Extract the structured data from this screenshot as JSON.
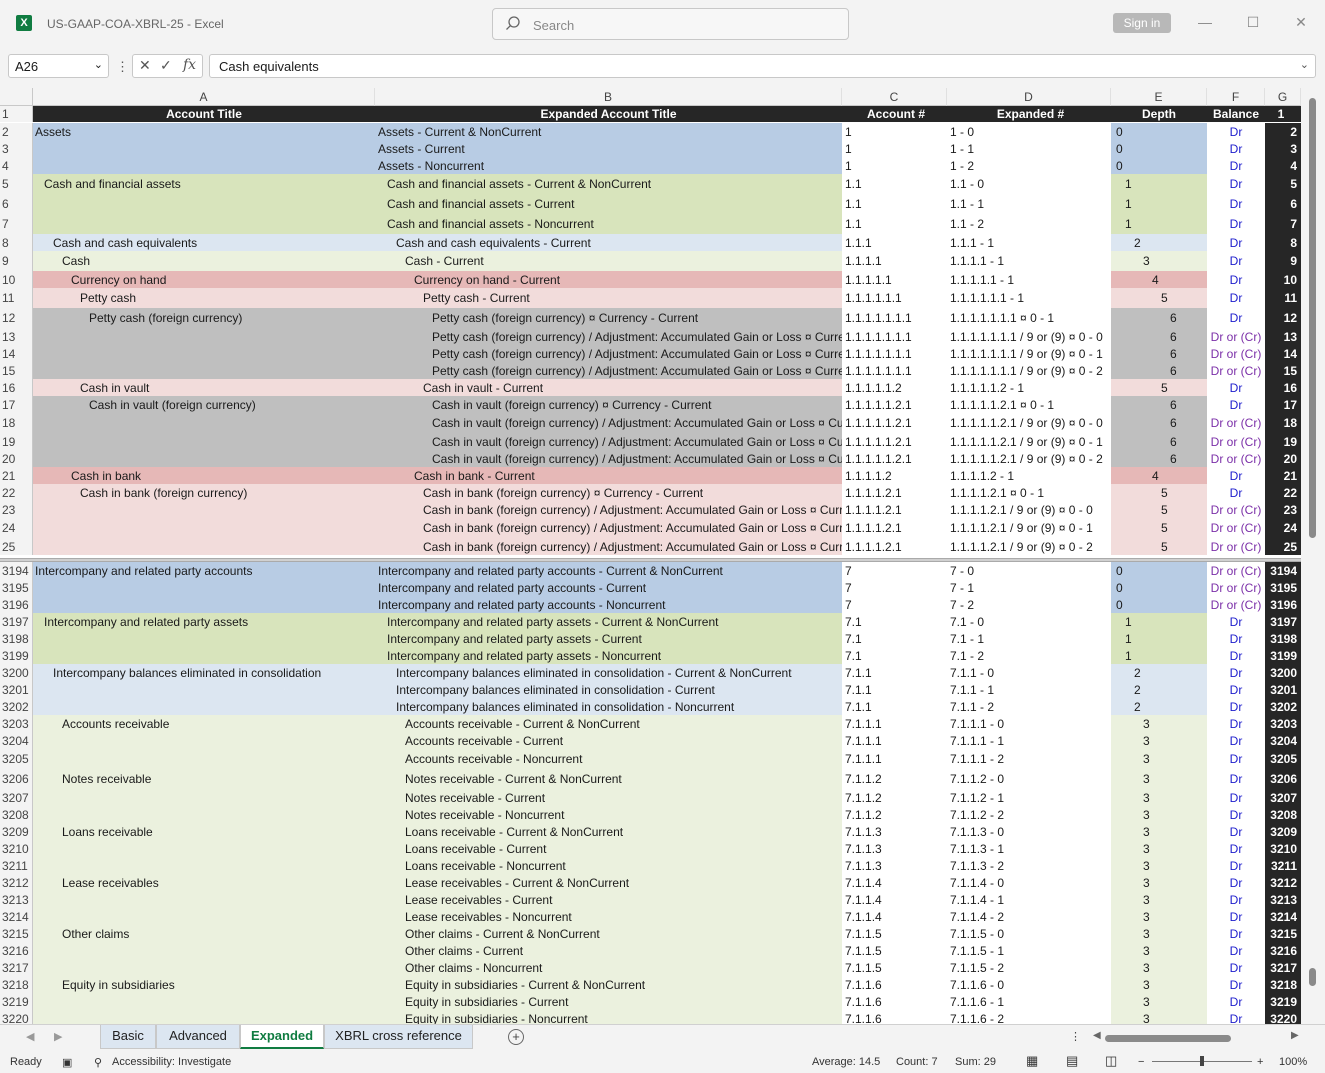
{
  "window": {
    "doc_title": "US-GAAP-COA-XBRL-25  -  Excel",
    "search_placeholder": "Search",
    "signin_label": "Sign in"
  },
  "formula_bar": {
    "name_box": "A26",
    "formula": "Cash equivalents"
  },
  "columns": [
    "A",
    "B",
    "C",
    "D",
    "E",
    "F",
    "G"
  ],
  "header_row": {
    "rn": "1",
    "a": "Account Title",
    "b": "Expanded Account Title",
    "c": "Account #",
    "d": "Expanded #",
    "e": "Depth",
    "f": "Balance",
    "g": "1"
  },
  "rows_top": [
    {
      "rn": "2",
      "a": "Assets",
      "b": "Assets - Current & NonCurrent",
      "c": "1",
      "d": "1 - 0",
      "e": "0",
      "f": "Dr",
      "g": "2",
      "color": "bl",
      "indent": 0
    },
    {
      "rn": "3",
      "a": "",
      "b": "Assets - Current",
      "c": "1",
      "d": "1 - 1",
      "e": "0",
      "f": "Dr",
      "g": "3",
      "color": "bl",
      "indent": 0
    },
    {
      "rn": "4",
      "a": "",
      "b": "Assets - Noncurrent",
      "c": "1",
      "d": "1 - 2",
      "e": "0",
      "f": "Dr",
      "g": "4",
      "color": "bl",
      "indent": 0
    },
    {
      "rn": "5",
      "a": "Cash and financial assets",
      "b": "Cash and financial assets - Current & NonCurrent",
      "c": "1.1",
      "d": "1.1 - 0",
      "e": "1",
      "f": "Dr",
      "g": "5",
      "color": "gr",
      "indent": 1
    },
    {
      "rn": "6",
      "a": "",
      "b": "Cash and financial assets - Current",
      "c": "1.1",
      "d": "1.1 - 1",
      "e": "1",
      "f": "Dr",
      "g": "6",
      "color": "gr",
      "indent": 1
    },
    {
      "rn": "7",
      "a": "",
      "b": "Cash and financial assets - Noncurrent",
      "c": "1.1",
      "d": "1.1 - 2",
      "e": "1",
      "f": "Dr",
      "g": "7",
      "color": "gr",
      "indent": 1
    },
    {
      "rn": "8",
      "a": "Cash and cash equivalents",
      "b": "Cash and cash equivalents - Current",
      "c": "1.1.1",
      "d": "1.1.1 - 1",
      "e": "2",
      "f": "Dr",
      "g": "8",
      "color": "lb",
      "indent": 2
    },
    {
      "rn": "9",
      "a": "Cash",
      "b": "Cash - Current",
      "c": "1.1.1.1",
      "d": "1.1.1.1 - 1",
      "e": "3",
      "f": "Dr",
      "g": "9",
      "color": "lg",
      "indent": 3
    },
    {
      "rn": "10",
      "a": "Currency on hand",
      "b": "Currency on hand - Current",
      "c": "1.1.1.1.1",
      "d": "1.1.1.1.1 - 1",
      "e": "4",
      "f": "Dr",
      "g": "10",
      "color": "rd",
      "indent": 4
    },
    {
      "rn": "11",
      "a": "Petty cash",
      "b": "Petty cash - Current",
      "c": "1.1.1.1.1.1",
      "d": "1.1.1.1.1.1 - 1",
      "e": "5",
      "f": "Dr",
      "g": "11",
      "color": "pk",
      "indent": 5
    },
    {
      "rn": "12",
      "a": "Petty cash (foreign currency)",
      "b": "Petty cash (foreign currency) ¤ Currency - Current",
      "c": "1.1.1.1.1.1.1",
      "d": "1.1.1.1.1.1.1 ¤ 0 - 1",
      "e": "6",
      "f": "Dr",
      "g": "12",
      "color": "gy",
      "indent": 6
    },
    {
      "rn": "13",
      "a": "",
      "b": "Petty cash (foreign currency) / Adjustment: Accumulated Gain or Loss ¤ Currency",
      "c": "1.1.1.1.1.1.1",
      "d": "1.1.1.1.1.1.1 / 9 or (9) ¤ 0 - 0",
      "e": "6",
      "f": "Dr or (Cr)",
      "g": "13",
      "color": "gy",
      "indent": 6
    },
    {
      "rn": "14",
      "a": "",
      "b": "Petty cash (foreign currency) / Adjustment: Accumulated Gain or Loss ¤ Currency",
      "c": "1.1.1.1.1.1.1",
      "d": "1.1.1.1.1.1.1 / 9 or (9) ¤ 0 - 1",
      "e": "6",
      "f": "Dr or (Cr)",
      "g": "14",
      "color": "gy",
      "indent": 6
    },
    {
      "rn": "15",
      "a": "",
      "b": "Petty cash (foreign currency) / Adjustment: Accumulated Gain or Loss ¤ Currency",
      "c": "1.1.1.1.1.1.1",
      "d": "1.1.1.1.1.1.1 / 9 or (9) ¤ 0 - 2",
      "e": "6",
      "f": "Dr or (Cr)",
      "g": "15",
      "color": "gy",
      "indent": 6
    },
    {
      "rn": "16",
      "a": "Cash in vault",
      "b": "Cash in vault - Current",
      "c": "1.1.1.1.1.2",
      "d": "1.1.1.1.1.2 - 1",
      "e": "5",
      "f": "Dr",
      "g": "16",
      "color": "pk",
      "indent": 5
    },
    {
      "rn": "17",
      "a": "Cash in vault (foreign currency)",
      "b": "Cash in vault (foreign currency) ¤ Currency - Current",
      "c": "1.1.1.1.1.2.1",
      "d": "1.1.1.1.1.2.1 ¤ 0 - 1",
      "e": "6",
      "f": "Dr",
      "g": "17",
      "color": "gy",
      "indent": 6
    },
    {
      "rn": "18",
      "a": "",
      "b": "Cash in vault (foreign currency) / Adjustment: Accumulated Gain or Loss ¤ Currency",
      "c": "1.1.1.1.1.2.1",
      "d": "1.1.1.1.1.2.1 / 9 or (9) ¤ 0 - 0",
      "e": "6",
      "f": "Dr or (Cr)",
      "g": "18",
      "color": "gy",
      "indent": 6
    },
    {
      "rn": "19",
      "a": "",
      "b": "Cash in vault (foreign currency) / Adjustment: Accumulated Gain or Loss ¤ Currency",
      "c": "1.1.1.1.1.2.1",
      "d": "1.1.1.1.1.2.1 / 9 or (9) ¤ 0 - 1",
      "e": "6",
      "f": "Dr or (Cr)",
      "g": "19",
      "color": "gy",
      "indent": 6
    },
    {
      "rn": "20",
      "a": "",
      "b": "Cash in vault (foreign currency) / Adjustment: Accumulated Gain or Loss ¤ Currency",
      "c": "1.1.1.1.1.2.1",
      "d": "1.1.1.1.1.2.1 / 9 or (9) ¤ 0 - 2",
      "e": "6",
      "f": "Dr or (Cr)",
      "g": "20",
      "color": "gy",
      "indent": 6
    },
    {
      "rn": "21",
      "a": "Cash in bank",
      "b": "Cash in bank - Current",
      "c": "1.1.1.1.2",
      "d": "1.1.1.1.2 - 1",
      "e": "4",
      "f": "Dr",
      "g": "21",
      "color": "rd",
      "indent": 4
    },
    {
      "rn": "22",
      "a": "Cash in bank (foreign currency)",
      "b": "Cash in bank (foreign currency) ¤ Currency - Current",
      "c": "1.1.1.1.2.1",
      "d": "1.1.1.1.2.1 ¤ 0 - 1",
      "e": "5",
      "f": "Dr",
      "g": "22",
      "color": "pk",
      "indent": 5
    },
    {
      "rn": "23",
      "a": "",
      "b": "Cash in bank (foreign currency) / Adjustment: Accumulated Gain or Loss ¤ Currency",
      "c": "1.1.1.1.2.1",
      "d": "1.1.1.1.2.1 / 9 or (9) ¤ 0 - 0",
      "e": "5",
      "f": "Dr or (Cr)",
      "g": "23",
      "color": "pk",
      "indent": 5
    },
    {
      "rn": "24",
      "a": "",
      "b": "Cash in bank (foreign currency) / Adjustment: Accumulated Gain or Loss ¤ Currency",
      "c": "1.1.1.1.2.1",
      "d": "1.1.1.1.2.1 / 9 or (9) ¤ 0 - 1",
      "e": "5",
      "f": "Dr or (Cr)",
      "g": "24",
      "color": "pk",
      "indent": 5
    },
    {
      "rn": "25",
      "a": "",
      "b": "Cash in bank (foreign currency) / Adjustment: Accumulated Gain or Loss ¤ Currency",
      "c": "1.1.1.1.2.1",
      "d": "1.1.1.1.2.1 / 9 or (9) ¤ 0 - 2",
      "e": "5",
      "f": "Dr or (Cr)",
      "g": "25",
      "color": "pk",
      "indent": 5
    }
  ],
  "rows_bottom": [
    {
      "rn": "3194",
      "a": "Intercompany and related party accounts",
      "b": "Intercompany and related party accounts - Current & NonCurrent",
      "c": "7",
      "d": "7 - 0",
      "e": "0",
      "f": "Dr or (Cr)",
      "g": "3194",
      "color": "bl",
      "indent": 0
    },
    {
      "rn": "3195",
      "a": "",
      "b": "Intercompany and related party accounts - Current",
      "c": "7",
      "d": "7 - 1",
      "e": "0",
      "f": "Dr or (Cr)",
      "g": "3195",
      "color": "bl",
      "indent": 0
    },
    {
      "rn": "3196",
      "a": "",
      "b": "Intercompany and related party accounts - Noncurrent",
      "c": "7",
      "d": "7 - 2",
      "e": "0",
      "f": "Dr or (Cr)",
      "g": "3196",
      "color": "bl",
      "indent": 0
    },
    {
      "rn": "3197",
      "a": "Intercompany and related party assets",
      "b": "Intercompany and related party assets - Current & NonCurrent",
      "c": "7.1",
      "d": "7.1 - 0",
      "e": "1",
      "f": "Dr",
      "g": "3197",
      "color": "gr",
      "indent": 1
    },
    {
      "rn": "3198",
      "a": "",
      "b": "Intercompany and related party assets - Current",
      "c": "7.1",
      "d": "7.1 - 1",
      "e": "1",
      "f": "Dr",
      "g": "3198",
      "color": "gr",
      "indent": 1
    },
    {
      "rn": "3199",
      "a": "",
      "b": "Intercompany and related party assets - Noncurrent",
      "c": "7.1",
      "d": "7.1 - 2",
      "e": "1",
      "f": "Dr",
      "g": "3199",
      "color": "gr",
      "indent": 1
    },
    {
      "rn": "3200",
      "a": "Intercompany balances eliminated in consolidation",
      "b": "Intercompany balances eliminated in consolidation - Current & NonCurrent",
      "c": "7.1.1",
      "d": "7.1.1 - 0",
      "e": "2",
      "f": "Dr",
      "g": "3200",
      "color": "lb",
      "indent": 2
    },
    {
      "rn": "3201",
      "a": "",
      "b": "Intercompany balances eliminated in consolidation - Current",
      "c": "7.1.1",
      "d": "7.1.1 - 1",
      "e": "2",
      "f": "Dr",
      "g": "3201",
      "color": "lb",
      "indent": 2
    },
    {
      "rn": "3202",
      "a": "",
      "b": "Intercompany balances eliminated in consolidation - Noncurrent",
      "c": "7.1.1",
      "d": "7.1.1 - 2",
      "e": "2",
      "f": "Dr",
      "g": "3202",
      "color": "lb",
      "indent": 2
    },
    {
      "rn": "3203",
      "a": "Accounts receivable",
      "b": "Accounts receivable - Current & NonCurrent",
      "c": "7.1.1.1",
      "d": "7.1.1.1 - 0",
      "e": "3",
      "f": "Dr",
      "g": "3203",
      "color": "lg",
      "indent": 3
    },
    {
      "rn": "3204",
      "a": "",
      "b": "Accounts receivable - Current",
      "c": "7.1.1.1",
      "d": "7.1.1.1 - 1",
      "e": "3",
      "f": "Dr",
      "g": "3204",
      "color": "lg",
      "indent": 3
    },
    {
      "rn": "3205",
      "a": "",
      "b": "Accounts receivable - Noncurrent",
      "c": "7.1.1.1",
      "d": "7.1.1.1 - 2",
      "e": "3",
      "f": "Dr",
      "g": "3205",
      "color": "lg",
      "indent": 3
    },
    {
      "rn": "3206",
      "a": "Notes receivable",
      "b": "Notes receivable - Current & NonCurrent",
      "c": "7.1.1.2",
      "d": "7.1.1.2 - 0",
      "e": "3",
      "f": "Dr",
      "g": "3206",
      "color": "lg",
      "indent": 3
    },
    {
      "rn": "3207",
      "a": "",
      "b": "Notes receivable - Current",
      "c": "7.1.1.2",
      "d": "7.1.1.2 - 1",
      "e": "3",
      "f": "Dr",
      "g": "3207",
      "color": "lg",
      "indent": 3
    },
    {
      "rn": "3208",
      "a": "",
      "b": "Notes receivable - Noncurrent",
      "c": "7.1.1.2",
      "d": "7.1.1.2 - 2",
      "e": "3",
      "f": "Dr",
      "g": "3208",
      "color": "lg",
      "indent": 3
    },
    {
      "rn": "3209",
      "a": "Loans receivable",
      "b": "Loans receivable - Current & NonCurrent",
      "c": "7.1.1.3",
      "d": "7.1.1.3 - 0",
      "e": "3",
      "f": "Dr",
      "g": "3209",
      "color": "lg",
      "indent": 3
    },
    {
      "rn": "3210",
      "a": "",
      "b": "Loans receivable - Current",
      "c": "7.1.1.3",
      "d": "7.1.1.3 - 1",
      "e": "3",
      "f": "Dr",
      "g": "3210",
      "color": "lg",
      "indent": 3
    },
    {
      "rn": "3211",
      "a": "",
      "b": "Loans receivable - Noncurrent",
      "c": "7.1.1.3",
      "d": "7.1.1.3 - 2",
      "e": "3",
      "f": "Dr",
      "g": "3211",
      "color": "lg",
      "indent": 3
    },
    {
      "rn": "3212",
      "a": "Lease receivables",
      "b": "Lease receivables - Current & NonCurrent",
      "c": "7.1.1.4",
      "d": "7.1.1.4 - 0",
      "e": "3",
      "f": "Dr",
      "g": "3212",
      "color": "lg",
      "indent": 3
    },
    {
      "rn": "3213",
      "a": "",
      "b": "Lease receivables - Current",
      "c": "7.1.1.4",
      "d": "7.1.1.4 - 1",
      "e": "3",
      "f": "Dr",
      "g": "3213",
      "color": "lg",
      "indent": 3
    },
    {
      "rn": "3214",
      "a": "",
      "b": "Lease receivables - Noncurrent",
      "c": "7.1.1.4",
      "d": "7.1.1.4 - 2",
      "e": "3",
      "f": "Dr",
      "g": "3214",
      "color": "lg",
      "indent": 3
    },
    {
      "rn": "3215",
      "a": "Other claims",
      "b": "Other claims - Current & NonCurrent",
      "c": "7.1.1.5",
      "d": "7.1.1.5 - 0",
      "e": "3",
      "f": "Dr",
      "g": "3215",
      "color": "lg",
      "indent": 3
    },
    {
      "rn": "3216",
      "a": "",
      "b": "Other claims - Current",
      "c": "7.1.1.5",
      "d": "7.1.1.5 - 1",
      "e": "3",
      "f": "Dr",
      "g": "3216",
      "color": "lg",
      "indent": 3
    },
    {
      "rn": "3217",
      "a": "",
      "b": "Other claims - Noncurrent",
      "c": "7.1.1.5",
      "d": "7.1.1.5 - 2",
      "e": "3",
      "f": "Dr",
      "g": "3217",
      "color": "lg",
      "indent": 3
    },
    {
      "rn": "3218",
      "a": "Equity in subsidiaries",
      "b": "Equity in subsidiaries - Current & NonCurrent",
      "c": "7.1.1.6",
      "d": "7.1.1.6 - 0",
      "e": "3",
      "f": "Dr",
      "g": "3218",
      "color": "lg",
      "indent": 3
    },
    {
      "rn": "3219",
      "a": "",
      "b": "Equity in subsidiaries - Current",
      "c": "7.1.1.6",
      "d": "7.1.1.6 - 1",
      "e": "3",
      "f": "Dr",
      "g": "3219",
      "color": "lg",
      "indent": 3
    },
    {
      "rn": "3220",
      "a": "",
      "b": "Equity in subsidiaries - Noncurrent",
      "c": "7.1.1.6",
      "d": "7.1.1.6 - 2",
      "e": "3",
      "f": "Dr",
      "g": "3220",
      "color": "lg",
      "indent": 3
    }
  ],
  "sheets": [
    {
      "label": "Basic",
      "active": false
    },
    {
      "label": "Advanced",
      "active": false
    },
    {
      "label": "Expanded",
      "active": true
    },
    {
      "label": "XBRL cross reference",
      "active": false
    }
  ],
  "status": {
    "ready": "Ready",
    "accessibility": "Accessibility: Investigate",
    "average": "Average: 14.5",
    "count": "Count: 7",
    "sum": "Sum: 29",
    "zoom": "100%"
  },
  "colors": {
    "bl": "#b8cce4",
    "gr": "#d8e4bc",
    "lb": "#dce6f1",
    "lg": "#ebf1de",
    "rd": "#e6b8b7",
    "pk": "#f2dcdb",
    "gy": "#bfbfbf",
    "excel_green": "#107c41"
  }
}
